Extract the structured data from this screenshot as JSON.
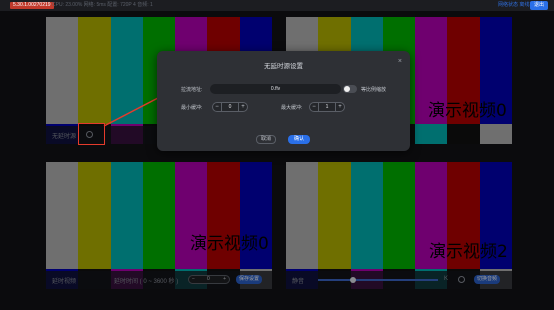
{
  "topbar": {
    "version": "5.30.1.00270219",
    "stats": "CPU: 23.00%   网络: 5ms   配置: 720P 4   音频: 1",
    "net_text": "网络状态  离线机位",
    "exit_label": "退出"
  },
  "tiles": [
    {
      "overlay": "",
      "label": "无延时源"
    },
    {
      "overlay": "演示视频0",
      "label": ""
    },
    {
      "overlay": "演示视频0",
      "label": "延时视频",
      "delay_label": "延时时间 ( 0 ~ 3600 秒 )",
      "delay_value": "0",
      "apply_label": "保存设置"
    },
    {
      "overlay": "演示视频2",
      "label": "静音",
      "volume_label": "K",
      "action_label": "切换音频"
    }
  ],
  "bar_colors": [
    "#b4b4b4",
    "#b4b400",
    "#00b4b4",
    "#00b400",
    "#b400b4",
    "#b40000",
    "#0000b4"
  ],
  "lower_colors": [
    "#0000b4",
    "#111111",
    "#b400b4",
    "#111111",
    "#00b4b4",
    "#111111",
    "#b4b4b4"
  ],
  "dialog": {
    "title": "无延时源设置",
    "close": "×",
    "addr_label": "拉流地址:",
    "addr_value": "0.flv",
    "toggle_label": "等比例缩放",
    "min_buffer_label": "最小缓冲:",
    "min_buffer_value": "0",
    "max_buffer_label": "最大缓冲:",
    "max_buffer_value": "1",
    "cancel_label": "取消",
    "confirm_label": "确认"
  }
}
